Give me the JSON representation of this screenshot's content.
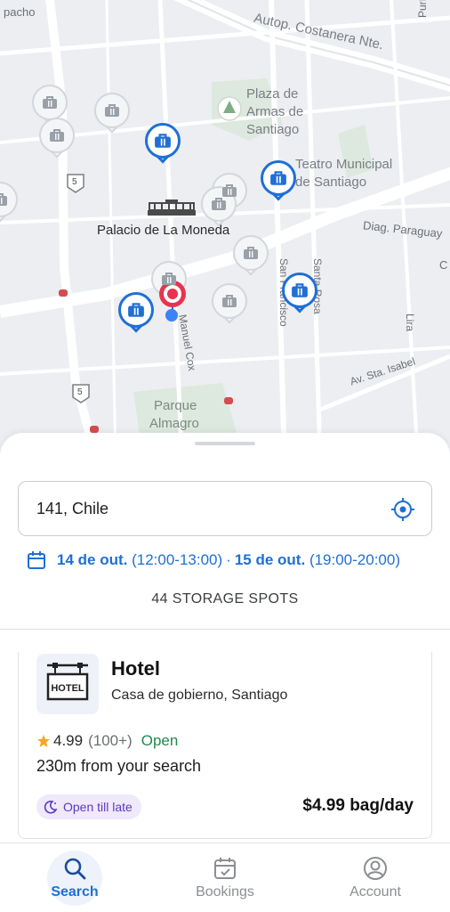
{
  "map": {
    "labels": {
      "road_top_left": "pacho",
      "costanera": "Autop. Costanera Nte.",
      "purisima": "Purísima",
      "plaza": "Plaza de Armas de Santiago",
      "plaza_l1": "Plaza de",
      "plaza_l2": "Armas de",
      "plaza_l3": "Santiago",
      "teatro_l1": "Teatro Municipal",
      "teatro_l2": "de Santiago",
      "moneda": "Palacio de La Moneda",
      "diag": "Diag. Paraguay",
      "san_francisco": "San Francisco",
      "santa_rosa": "Santa Rosa",
      "lira": "Lira",
      "sta_isabel": "Av. Sta. Isabel",
      "cox": "Manuel Cox",
      "parque_l1": "Parque",
      "parque_l2": "Almagro",
      "route_shield": "5",
      "c_letter": "C"
    }
  },
  "search": {
    "value": "141, Chile",
    "location_icon": "crosshair-icon"
  },
  "dates": {
    "start_day": "14 de out.",
    "start_time": "(12:00-13:00)",
    "separator": "·",
    "end_day": "15 de out.",
    "end_time": "(19:00-20:00)"
  },
  "results": {
    "count_label": "44 STORAGE SPOTS"
  },
  "listing": {
    "title": "Hotel",
    "address": "Casa de gobierno, Santiago",
    "rating": "4.99",
    "reviews": "(100+)",
    "status": "Open",
    "distance": "230m from your search",
    "badge": "Open till late",
    "price": "$4.99 bag/day",
    "thumb_sign": "HOTEL"
  },
  "nav": {
    "items": [
      {
        "label": "Search",
        "active": true
      },
      {
        "label": "Bookings",
        "active": false
      },
      {
        "label": "Account",
        "active": false
      }
    ]
  },
  "colors": {
    "accent": "#1f6fd6",
    "open": "#1e8a4c",
    "badge_bg": "#efe9fb",
    "badge_text": "#5b3bbf",
    "marker_red": "#e8334f"
  }
}
